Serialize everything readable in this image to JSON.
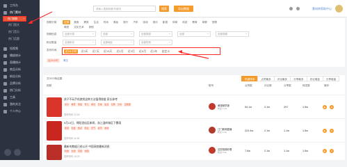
{
  "sidebar": {
    "items": [
      {
        "label": "工作台"
      },
      {
        "label": "热门素材"
      }
    ],
    "subitems": [
      {
        "label": "热门视频",
        "selected": true
      },
      {
        "label": "热门图文"
      },
      {
        "label": "热门音乐"
      },
      {
        "label": "热门话题"
      }
    ],
    "lower": [
      {
        "label": "短视频"
      },
      {
        "label": "播放统计"
      },
      {
        "label": "直播统计"
      },
      {
        "label": "商品分析"
      },
      {
        "label": "粉丝分析"
      },
      {
        "label": "品牌分析"
      },
      {
        "label": "热门分析"
      },
      {
        "label": "工具"
      },
      {
        "label": "我的关注"
      },
      {
        "label": "个人中心"
      }
    ]
  },
  "topbar": {
    "search_placeholder": "请输入视频标题/关键词",
    "search_button": "搜索",
    "export_button": "导出数据",
    "link": "素材库帮助中心"
  },
  "filters": {
    "category_label": "视频分类",
    "categories": [
      "全部",
      "美食",
      "搞笑",
      "生活",
      "时尚",
      "美妆",
      "旅行",
      "汽车",
      "游戏",
      "音乐",
      "影视",
      "体育",
      "科技",
      "教育",
      "母婴",
      "宠物"
    ],
    "categories2": [
      "萌宠",
      "文化艺术",
      "其他"
    ],
    "account_label": "视频信息",
    "account_selects": [
      "全部分类",
      "全部",
      "全部类型",
      "全部",
      "全部视频"
    ],
    "fans_label": "粉丝数量",
    "fans_selects": [
      "全部粉丝",
      "全部地区",
      "全部性别"
    ],
    "time_label": "发布时间",
    "time_options": [
      {
        "label": "近24小时",
        "on": true
      },
      {
        "label": "近3天",
        "on": false
      },
      {
        "label": "近7天",
        "on": false
      },
      {
        "label": "近15天",
        "on": false
      },
      {
        "label": "近1月",
        "on": false
      },
      {
        "label": "近3月",
        "on": false
      },
      {
        "label": "近6月",
        "on": false
      },
      {
        "label": "近1年",
        "on": false
      },
      {
        "label": "自定义",
        "on": false
      }
    ],
    "selected_chip": "近24小时",
    "reset": "清空"
  },
  "results": {
    "count_text": "共3575条结果",
    "sort_tabs": [
      {
        "label": "热度排序",
        "on": true
      },
      {
        "label": "点赞最多",
        "on": false
      },
      {
        "label": "评论最多",
        "on": false
      },
      {
        "label": "分享最多",
        "on": false
      },
      {
        "label": "评论增量",
        "on": false
      },
      {
        "label": "分享增量",
        "on": false
      },
      {
        "label": "播放增量",
        "on": false
      }
    ],
    "headers": [
      "视频",
      "账号",
      "点赞数",
      "评论数",
      "分享数",
      "转发数",
      "操作"
    ]
  },
  "rows": [
    {
      "title": "孩子不玩手机就闹这种方法值得借鉴 家长参考",
      "tags": [
        "亲子",
        "教育",
        "家庭",
        "育儿",
        "成长",
        "日常",
        "生活",
        "记录",
        "分享",
        "正能量"
      ],
      "meta": "发布时间: 12:00",
      "account": "黄视频早报",
      "fans": "粉丝 1.2w",
      "likes": "54.1w",
      "comments": "2.1w",
      "shares": "297",
      "forwards": "1.5w",
      "thumb_color": "#d9352b"
    },
    {
      "title": "9月13日，绵阳游仙区新闻，浙江温岭城区下暴雨",
      "tags": [
        "新闻",
        "社会",
        "热点",
        "民生",
        "天气",
        "资讯",
        "本地"
      ],
      "meta": "发布时间: 11:30",
      "account": "江门新闻直播",
      "fans": "粉丝 3.4w",
      "likes": "224.4w",
      "comments": "2.1w",
      "shares": "1.1w",
      "forwards": "1.5w",
      "thumb_color": "#c8261e"
    },
    {
      "title": "最新的数据已经公开 中国高铁最新消息",
      "tags": [
        "科技",
        "交通",
        "高铁",
        "中国"
      ],
      "meta": "发布时间: 10:20",
      "account": "这些视频好看",
      "fans": "粉丝 5.6w",
      "likes": "7.6w",
      "comments": "2.1w",
      "shares": "1.1w",
      "forwards": "1.5w",
      "thumb_color": "#b92e26"
    }
  ]
}
